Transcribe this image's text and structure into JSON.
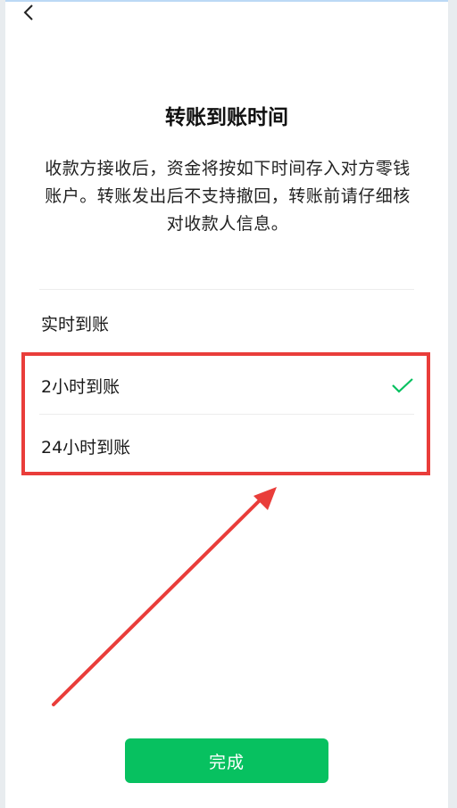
{
  "header": {
    "back_icon": "chevron-left-icon"
  },
  "page": {
    "title": "转账到账时间",
    "description": "收款方接收后，资金将按如下时间存入对方零钱账户。转账发出后不支持撤回，转账前请仔细核对收款人信息。"
  },
  "options": [
    {
      "label": "实时到账",
      "selected": false
    },
    {
      "label": "2小时到账",
      "selected": true
    },
    {
      "label": "24小时到账",
      "selected": false
    }
  ],
  "footer": {
    "done_label": "完成"
  },
  "colors": {
    "accent": "#07c160",
    "annotation": "#e93d3a"
  }
}
